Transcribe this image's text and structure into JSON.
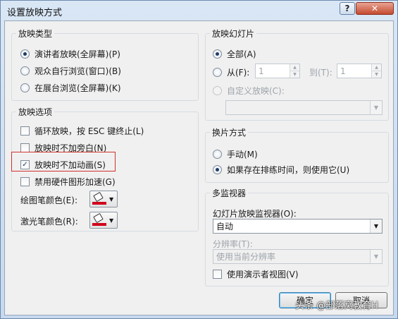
{
  "window": {
    "title": "设置放映方式",
    "help_glyph": "?",
    "close_glyph": "✕"
  },
  "show_type": {
    "title": "放映类型",
    "options": [
      {
        "label": "演讲者放映(全屏幕)(P)",
        "selected": true
      },
      {
        "label": "观众自行浏览(窗口)(B)",
        "selected": false
      },
      {
        "label": "在展台浏览(全屏幕)(K)",
        "selected": false
      }
    ]
  },
  "show_slides": {
    "title": "放映幻灯片",
    "all_label": "全部(A)",
    "from_label": "从(F):",
    "from_value": "1",
    "to_label": "到(T):",
    "to_value": "1",
    "custom_label": "自定义放映(C):",
    "custom_value": ""
  },
  "show_options": {
    "title": "放映选项",
    "loop_label": "循环放映，按 ESC 键终止(L)",
    "no_narration_label": "放映时不加旁白(N)",
    "no_animation_label": "放映时不加动画(S)",
    "hw_accel_label": "禁用硬件图形加速(G)",
    "pen_color_label": "绘图笔颜色(E):",
    "laser_color_label": "激光笔颜色(R):",
    "loop_checked": false,
    "no_narration_checked": false,
    "no_animation_checked": true,
    "hw_accel_checked": false,
    "pen_color": "#d0021b",
    "laser_color": "#d0021b"
  },
  "advance": {
    "title": "换片方式",
    "manual_label": "手动(M)",
    "timings_label": "如果存在排练时间，则使用它(U)",
    "manual_selected": false,
    "timings_selected": true
  },
  "monitors": {
    "title": "多监视器",
    "monitor_label": "幻灯片放映监视器(O):",
    "monitor_value": "自动",
    "resolution_label": "分辨率(T):",
    "resolution_value": "使用当前分辨率",
    "presenter_view_label": "使用演示者视图(V)",
    "presenter_view_checked": false
  },
  "buttons": {
    "ok_label": "确定",
    "cancel_label": "取消"
  },
  "watermark": "头条 @部落窝教育H",
  "colors": {
    "highlight": "#d0312d",
    "title_bar": "#c7d9ee"
  }
}
